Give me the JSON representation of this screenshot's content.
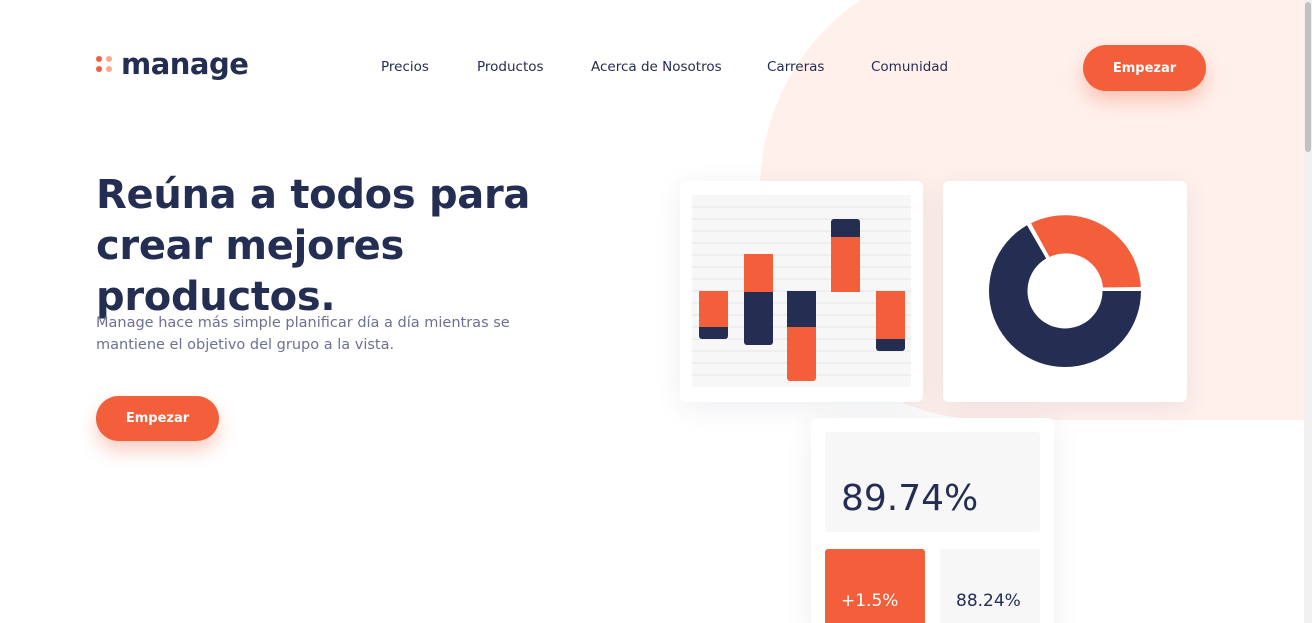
{
  "header": {
    "logo_text": "manage",
    "nav": [
      "Precios",
      "Productos",
      "Acerca de Nosotros",
      "Carreras",
      "Comunidad"
    ],
    "cta_label": "Empezar"
  },
  "hero": {
    "title": "Reúna a todos para crear mejores productos.",
    "text": "Manage hace más simple planificar día a día mientras se mantiene el objetivo del grupo a la vista.",
    "cta_label": "Empezar"
  },
  "stats": {
    "main_value": "89.74%",
    "change_value": "+1.5%",
    "secondary_value": "88.24%"
  },
  "colors": {
    "accent": "#f25f3a",
    "navy": "#242d52",
    "blush": "#fff0ec",
    "muted_text": "#6d7191"
  }
}
